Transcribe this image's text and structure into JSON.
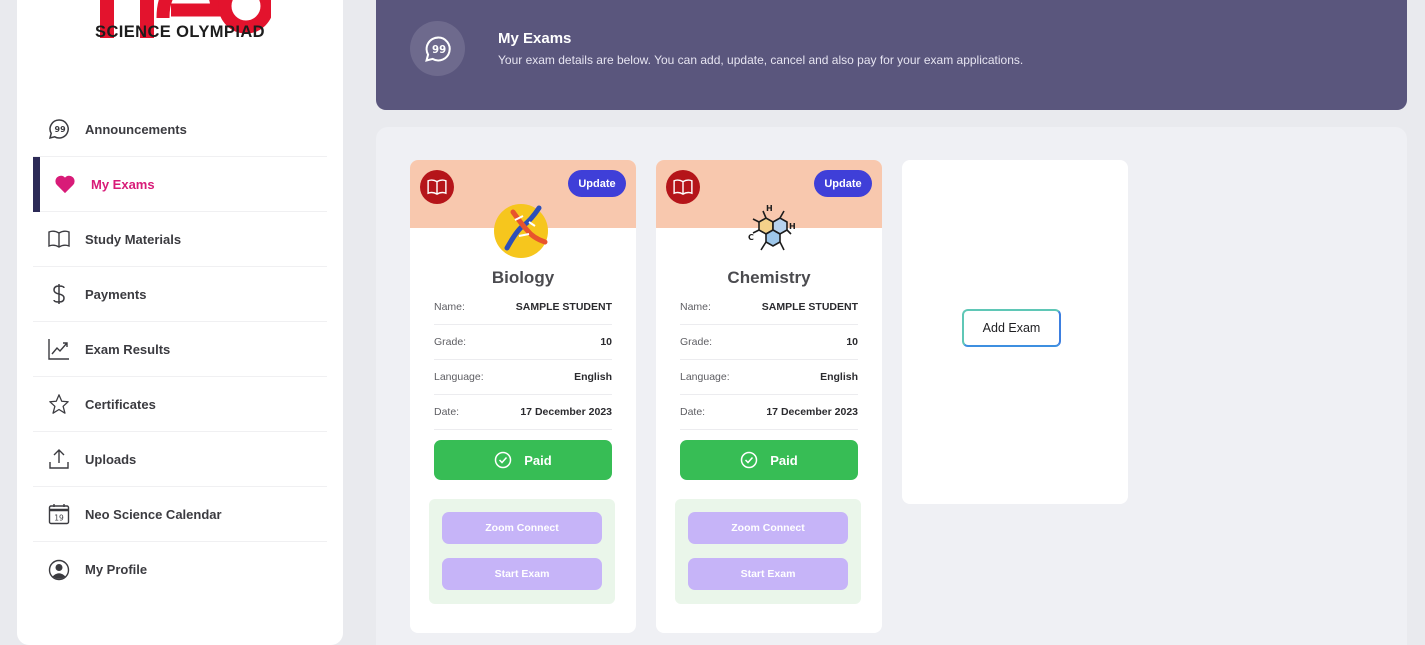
{
  "logo": {
    "brand": "neo",
    "subtitle": "SCIENCE OLYMPIAD"
  },
  "sidebar": {
    "items": [
      {
        "label": "Announcements",
        "icon": "chat-bubble-icon",
        "active": false
      },
      {
        "label": "My Exams",
        "icon": "heart-icon",
        "active": true
      },
      {
        "label": "Study Materials",
        "icon": "open-book-icon",
        "active": false
      },
      {
        "label": "Payments",
        "icon": "dollar-icon",
        "active": false
      },
      {
        "label": "Exam Results",
        "icon": "trend-chart-icon",
        "active": false
      },
      {
        "label": "Certificates",
        "icon": "star-icon",
        "active": false
      },
      {
        "label": "Uploads",
        "icon": "upload-icon",
        "active": false
      },
      {
        "label": "Neo Science Calendar",
        "icon": "calendar-icon",
        "active": false
      },
      {
        "label": "My Profile",
        "icon": "user-circle-icon",
        "active": false
      }
    ],
    "calendar_day": "19"
  },
  "banner": {
    "title": "My Exams",
    "subtitle": "Your exam details are below. You can add, update, cancel and also pay for your exam applications."
  },
  "labels": {
    "name": "Name:",
    "grade": "Grade:",
    "language": "Language:",
    "date": "Date:",
    "update": "Update",
    "paid": "Paid",
    "zoom": "Zoom Connect",
    "start": "Start Exam",
    "add_exam": "Add Exam"
  },
  "exams": [
    {
      "subject": "Biology",
      "name": "SAMPLE STUDENT",
      "grade": "10",
      "language": "English",
      "date": "17 December 2023",
      "status": "Paid"
    },
    {
      "subject": "Chemistry",
      "name": "SAMPLE STUDENT",
      "grade": "10",
      "language": "English",
      "date": "17 December 2023",
      "status": "Paid"
    }
  ],
  "chem_labels": {
    "h1": "H",
    "h2": "H",
    "c": "C"
  },
  "colors": {
    "brand_red": "#e3132d",
    "active_pink": "#d81b78",
    "banner": "#5a567d",
    "card_header": "#f8c8ae",
    "update_button": "#3f3fd8",
    "paid_green": "#37bd55",
    "disabled_purple": "#c6b4f8"
  }
}
